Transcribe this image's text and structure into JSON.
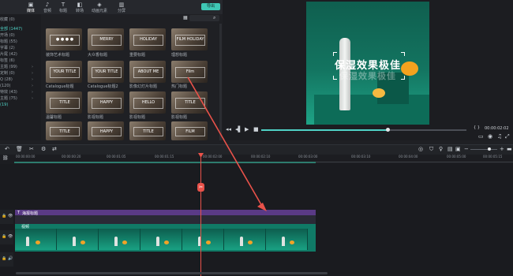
{
  "toolbar": {
    "tabs": [
      {
        "label": "媒体",
        "icon": "folder-icon"
      },
      {
        "label": "音频",
        "icon": "music-icon"
      },
      {
        "label": "标题",
        "icon": "text-icon"
      },
      {
        "label": "转场",
        "icon": "transition-icon"
      },
      {
        "label": "动画元素",
        "icon": "element-icon"
      },
      {
        "label": "分屏",
        "icon": "split-screen-icon"
      }
    ],
    "export_label": "导出"
  },
  "sidebar": {
    "items": [
      {
        "label": "收藏 (0)"
      },
      {
        "label": "全部 (1447)"
      },
      {
        "label": "开场 (0)"
      },
      {
        "label": "标题 (55)"
      },
      {
        "label": "字幕 (2)"
      },
      {
        "label": "片尾 (42)"
      },
      {
        "label": "标签 (6)"
      },
      {
        "label": "主题 (99)"
      },
      {
        "label": "定制 (0)"
      },
      {
        "label": "Q (28)"
      },
      {
        "label": "(120)"
      },
      {
        "label": "特效 (43)"
      },
      {
        "label": "主题 (75)"
      },
      {
        "label": "(19)"
      }
    ]
  },
  "media": {
    "thumbs": [
      {
        "cap": "● ● ● ●",
        "label": "装饰艺术标题"
      },
      {
        "cap": "MERRY",
        "label": "大众香标题"
      },
      {
        "cap": "HOLIDAY",
        "label": "重要标题"
      },
      {
        "cap": "FILM HOLIDAY",
        "label": "理想标题"
      },
      {
        "cap": "YOUR TITLE",
        "label": "Catalogue标题"
      },
      {
        "cap": "YOUR TITLE",
        "label": "Catalogue标题2"
      },
      {
        "cap": "ABOUT ME",
        "label": "影像幻灯片标题"
      },
      {
        "cap": "Film",
        "label": "热门标题"
      },
      {
        "cap": "TITLE",
        "label": "温馨标题"
      },
      {
        "cap": "HAPPY",
        "label": "影视标题"
      },
      {
        "cap": "HELLO",
        "label": "影视标题"
      },
      {
        "cap": "TITLE",
        "label": "影视标题"
      },
      {
        "cap": "TITLE",
        "label": ""
      },
      {
        "cap": "HAPPY",
        "label": ""
      },
      {
        "cap": "TITLE",
        "label": ""
      },
      {
        "cap": "FILM",
        "label": ""
      }
    ]
  },
  "preview": {
    "headline": "保湿效果极佳",
    "subline": "保湿效果极佳",
    "time": "00:00:02:02"
  },
  "timeline": {
    "ruler": [
      "00:00:00:00",
      "00:00:00:20",
      "00:00:01:05",
      "00:00:01:15",
      "00:00:02:00",
      "00:00:02:10",
      "00:00:03:00",
      "00:00:03:10",
      "00:00:04:00",
      "00:00:05:00",
      "00:00:05:15",
      "00:00:06:00",
      "00:00:07:00",
      "00:00:07:15",
      "00:00:08:00"
    ],
    "title_clip_label": "海报标题",
    "video_clip_label": "视频"
  },
  "colors": {
    "accent": "#4fd1c5",
    "playhead": "#e9524a",
    "title_clip": "#5a3a86",
    "video_clip": "#107a66"
  }
}
